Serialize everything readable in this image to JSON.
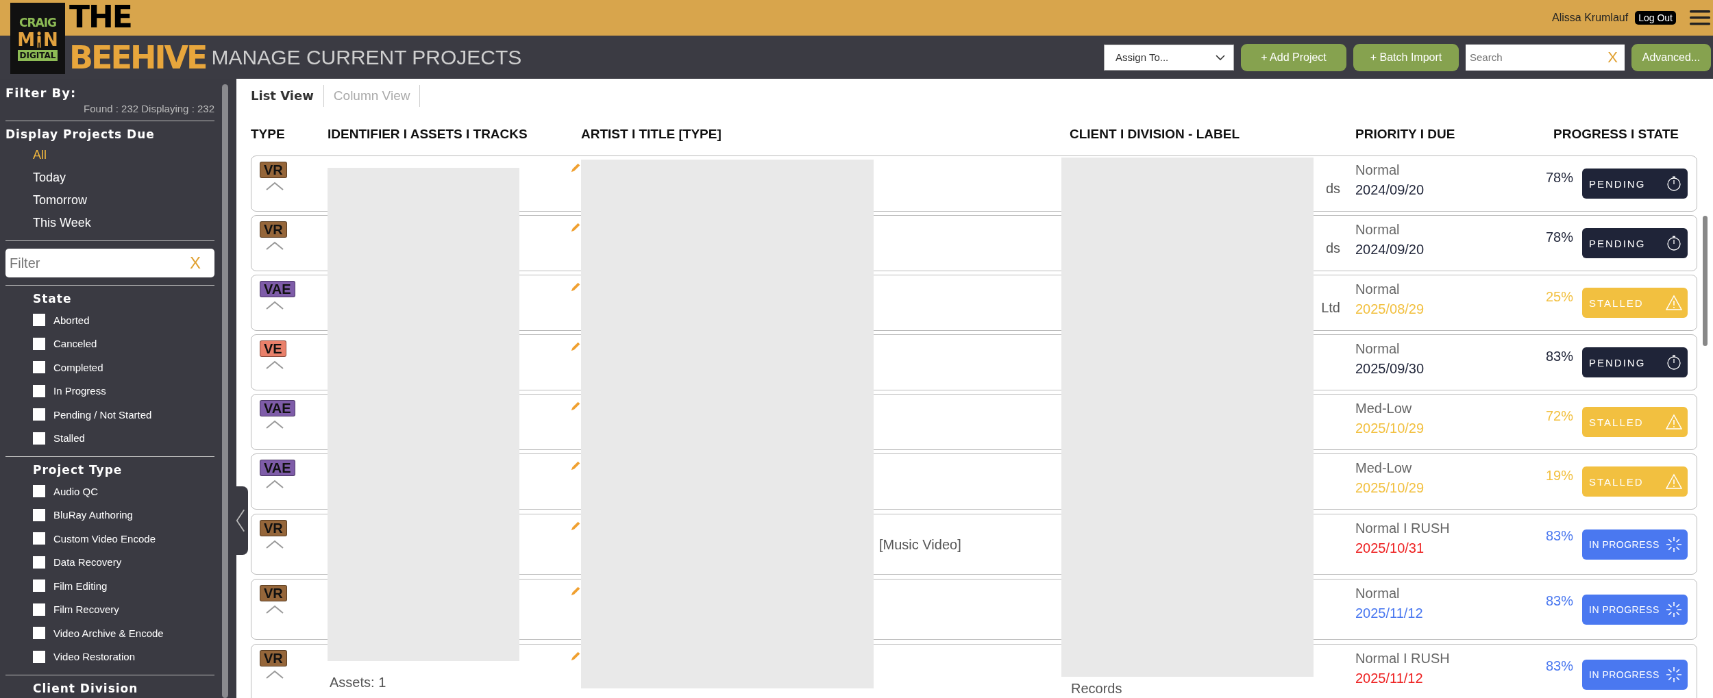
{
  "logo": {
    "lines": [
      "CRAIG",
      "M",
      "N",
      "DIGITAL"
    ]
  },
  "app_title": {
    "line1": "THE",
    "line2": "BEEHIVE"
  },
  "page_title": "MANAGE CURRENT PROJECTS",
  "user": {
    "name": "Alissa Krumlauf",
    "logout": "Log Out"
  },
  "toolbar": {
    "assign": "Assign To...",
    "add_project": "+ Add Project",
    "batch_import": "+ Batch Import",
    "search": {
      "placeholder": "Search",
      "clear": "X"
    },
    "advanced": "Advanced..."
  },
  "sidebar": {
    "title": "Filter By:",
    "counts": "Found : 232 Displaying : 232",
    "due_heading": "Display Projects Due",
    "due_options": [
      {
        "label": "All",
        "selected": true
      },
      {
        "label": "Today",
        "selected": false
      },
      {
        "label": "Tomorrow",
        "selected": false
      },
      {
        "label": "This Week",
        "selected": false
      }
    ],
    "filter": {
      "placeholder": "Filter",
      "clear": "X"
    },
    "groups": [
      {
        "heading": "State",
        "items": [
          {
            "label": "Aborted",
            "checked": false
          },
          {
            "label": "Canceled",
            "checked": false
          },
          {
            "label": "Completed",
            "checked": false
          },
          {
            "label": "In Progress",
            "checked": false
          },
          {
            "label": "Pending / Not Started",
            "checked": false
          },
          {
            "label": "Stalled",
            "checked": false
          }
        ]
      },
      {
        "heading": "Project Type",
        "items": [
          {
            "label": "Audio QC",
            "checked": false
          },
          {
            "label": "BluRay Authoring",
            "checked": false
          },
          {
            "label": "Custom Video Encode",
            "checked": false
          },
          {
            "label": "Data Recovery",
            "checked": false
          },
          {
            "label": "Film Editing",
            "checked": false
          },
          {
            "label": "Film Recovery",
            "checked": false
          },
          {
            "label": "Video Archive & Encode",
            "checked": false
          },
          {
            "label": "Video Restoration",
            "checked": false
          }
        ]
      },
      {
        "heading": "Client Division"
      }
    ]
  },
  "view_tabs": [
    {
      "label": "List View",
      "selected": true
    },
    {
      "label": "Column View",
      "selected": false
    }
  ],
  "table": {
    "columns": [
      "TYPE",
      "IDENTIFIER I ASSETS I TRACKS",
      "ARTIST I TITLE [TYPE]",
      "CLIENT I DIVISION - LABEL",
      "PRIORITY I DUE",
      "PROGRESS I STATE"
    ],
    "rows": [
      {
        "type": {
          "label": "VR",
          "color": "#95663a"
        },
        "client": {
          "kind": "tail",
          "text": "ds"
        },
        "priority": "Normal",
        "due": {
          "text": "2024/09/20",
          "color": "#1f2438"
        },
        "progress": "78%",
        "state": {
          "kind": "pending",
          "label": "PENDING"
        }
      },
      {
        "type": {
          "label": "VR",
          "color": "#95663a"
        },
        "client": {
          "kind": "tail",
          "text": "ds"
        },
        "priority": "Normal",
        "due": {
          "text": "2024/09/20",
          "color": "#1f2438"
        },
        "progress": "78%",
        "state": {
          "kind": "pending",
          "label": "PENDING"
        }
      },
      {
        "type": {
          "label": "VAE",
          "color": "#7e5ca8"
        },
        "client": {
          "kind": "tail",
          "text": "Ltd"
        },
        "priority": "Normal",
        "due": {
          "text": "2025/08/29",
          "color": "#f2c040"
        },
        "progress": "25%",
        "state": {
          "kind": "stalled",
          "label": "STALLED"
        }
      },
      {
        "type": {
          "label": "VE",
          "color": "#e9806a"
        },
        "priority": "Normal",
        "due": {
          "text": "2025/09/30",
          "color": "#1f2438"
        },
        "progress": "83%",
        "state": {
          "kind": "pending",
          "label": "PENDING"
        }
      },
      {
        "type": {
          "label": "VAE",
          "color": "#7e5ca8"
        },
        "priority": "Med-Low",
        "due": {
          "text": "2025/10/29",
          "color": "#f2c040"
        },
        "progress": "72%",
        "state": {
          "kind": "stalled",
          "label": "STALLED"
        }
      },
      {
        "type": {
          "label": "VAE",
          "color": "#7e5ca8"
        },
        "priority": "Med-Low",
        "due": {
          "text": "2025/10/29",
          "color": "#f2c040"
        },
        "progress": "19%",
        "state": {
          "kind": "stalled",
          "label": "STALLED"
        }
      },
      {
        "type": {
          "label": "VR",
          "color": "#95663a"
        },
        "artist": "[Music Video]",
        "priority": "Normal I RUSH",
        "due": {
          "text": "2025/10/31",
          "color": "#ee2222"
        },
        "progress": "83%",
        "state": {
          "kind": "in_progress",
          "label": "IN PROGRESS"
        }
      },
      {
        "type": {
          "label": "VR",
          "color": "#95663a"
        },
        "priority": "Normal",
        "due": {
          "text": "2025/11/12",
          "color": "#4a78f0"
        },
        "progress": "83%",
        "state": {
          "kind": "in_progress",
          "label": "IN PROGRESS"
        }
      },
      {
        "type": {
          "label": "VR",
          "color": "#95663a"
        },
        "identifier": {
          "kind": "bottom",
          "text": "Assets: 1"
        },
        "client": {
          "kind": "line",
          "text": "Records"
        },
        "priority": "Normal I RUSH",
        "due": {
          "text": "2025/11/12",
          "color": "#ee2222"
        },
        "progress": "83%",
        "state": {
          "kind": "in_progress",
          "label": "IN PROGRESS"
        }
      }
    ]
  }
}
